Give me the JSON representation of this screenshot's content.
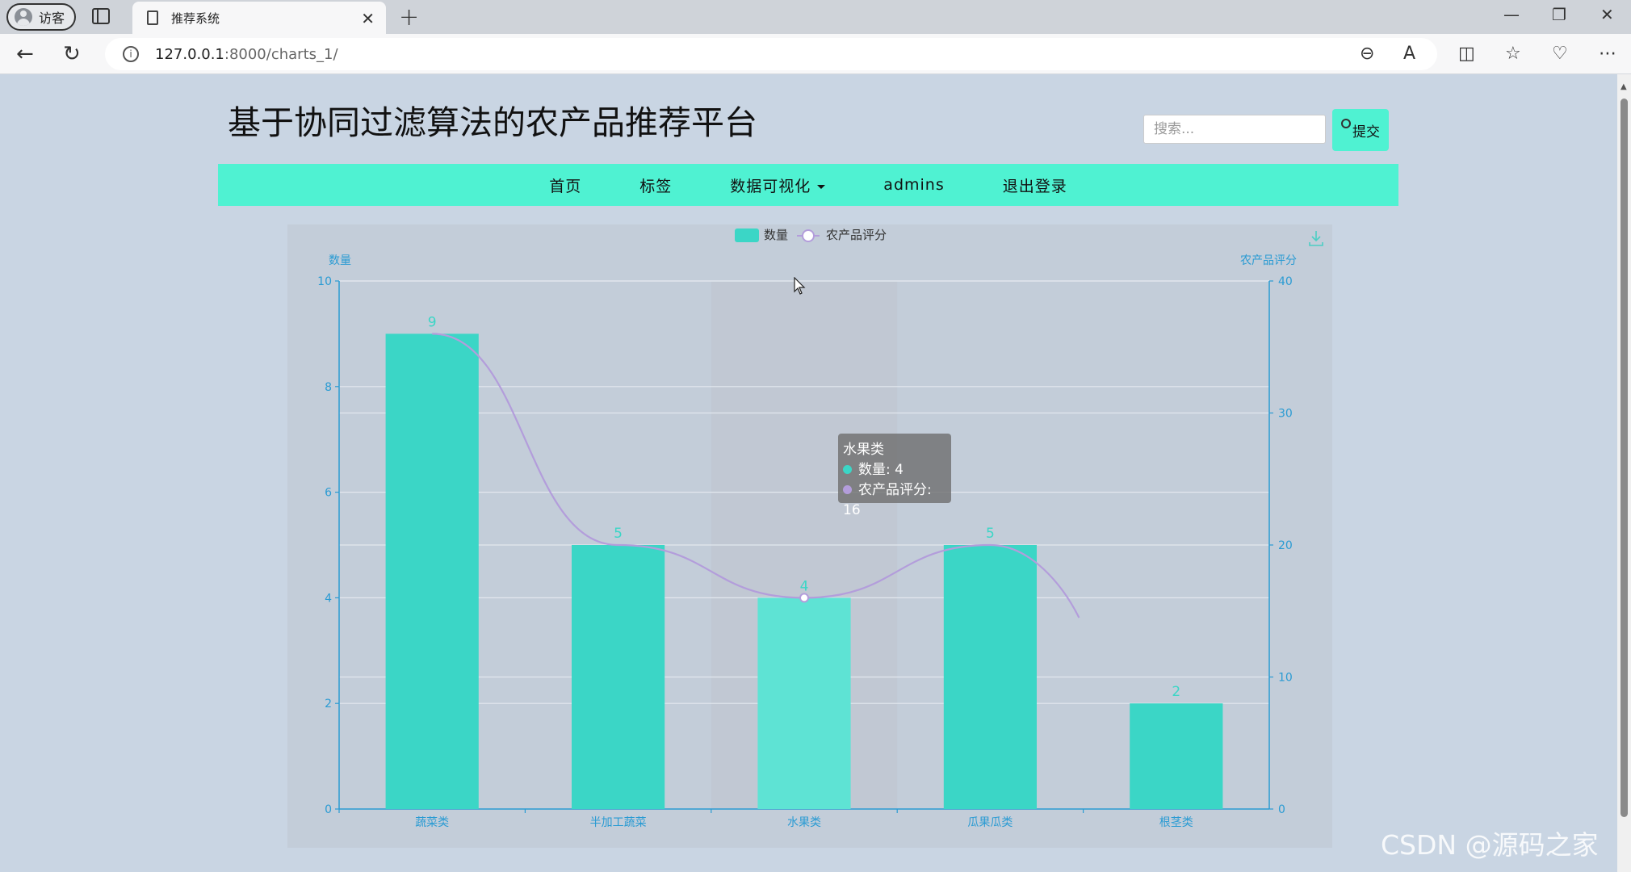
{
  "browser": {
    "profile_label": "访客",
    "tab_title": "推荐系统",
    "url_host": "127.0.0.1",
    "url_path": ":8000/charts_1/"
  },
  "site": {
    "title": "基于协同过滤算法的农产品推荐平台",
    "search_placeholder": "搜索...",
    "search_button": "提交",
    "nav": [
      "首页",
      "标签",
      "数据可视化",
      "admins",
      "退出登录"
    ]
  },
  "tooltip": {
    "title": "水果类",
    "line1": "数量: 4",
    "line2": "农产品评分: 16"
  },
  "watermark": "CSDN @源码之家",
  "colors": {
    "accent": "#4ff2d2",
    "bar": "#3bd6c6",
    "bar_highlight": "#5ee3d4",
    "line": "#b39ddb",
    "axis": "#2a9bd3"
  },
  "chart_data": {
    "type": "bar",
    "categories": [
      "蔬菜类",
      "半加工蔬菜",
      "水果类",
      "瓜果瓜类",
      "根茎类"
    ],
    "series": [
      {
        "name": "数量",
        "type": "bar",
        "axis": "left",
        "values": [
          9,
          5,
          4,
          5,
          2
        ]
      },
      {
        "name": "农产品评分",
        "type": "line",
        "axis": "right",
        "values": [
          36,
          20,
          16,
          20,
          null
        ]
      }
    ],
    "ylabel": "数量",
    "y2label": "农产品评分",
    "ylim": [
      0,
      10
    ],
    "y2lim": [
      0,
      40
    ],
    "yticks": [
      0,
      2,
      4,
      6,
      8,
      10
    ],
    "y2ticks": [
      0,
      10,
      20,
      30,
      40
    ],
    "legend": "top-center",
    "grid": true
  }
}
